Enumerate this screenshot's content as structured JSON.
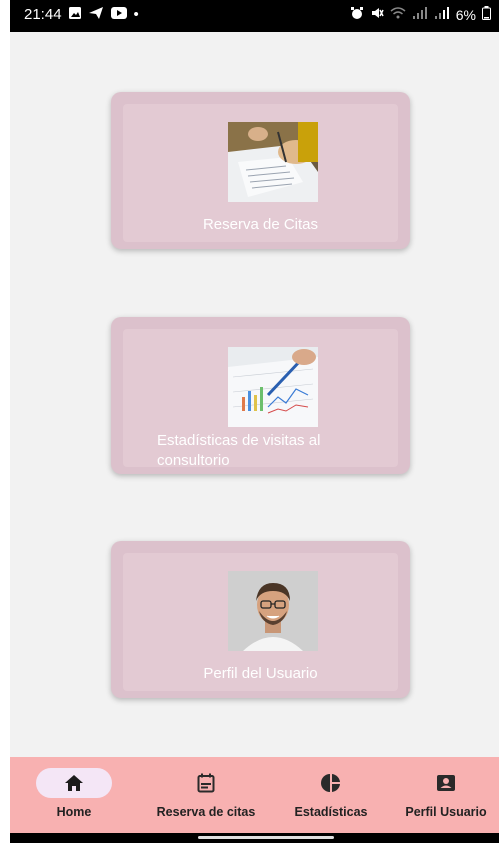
{
  "status_bar": {
    "time": "21:44",
    "dot": "•",
    "battery": "6%",
    "left_icons": [
      "image-icon",
      "send-icon",
      "youtube-icon"
    ],
    "right_icons": [
      "alarm-icon",
      "mute-icon",
      "wifi-icon",
      "signal-icon",
      "signal-icon",
      "battery-icon"
    ]
  },
  "cards": [
    {
      "label": "Reserva de Citas",
      "image": "writing-hands-photo"
    },
    {
      "label": "Estadísticas de visitas al consultorio",
      "image": "charts-pen-photo"
    },
    {
      "label": "Perfil del Usuario",
      "image": "smiling-man-photo"
    }
  ],
  "nav": {
    "items": [
      {
        "label": "Home",
        "icon": "home-icon",
        "active": true
      },
      {
        "label": "Reserva de citas",
        "icon": "calendar-icon",
        "active": false
      },
      {
        "label": "Estadísticas",
        "icon": "pie-chart-icon",
        "active": false
      },
      {
        "label": "Perfil Usuario",
        "icon": "account-box-icon",
        "active": false
      }
    ]
  },
  "colors": {
    "background": "#f2f2f2",
    "card_outer": "#dcc1cc",
    "card_inner": "#e3cad3",
    "nav_bar": "#f8b1b1",
    "active_pill": "#f4e6f6"
  }
}
